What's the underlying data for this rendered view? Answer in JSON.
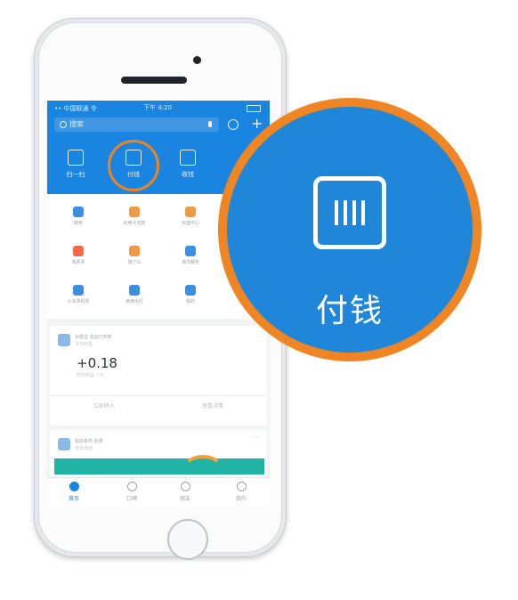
{
  "status_bar": {
    "carrier": "•• 中国联通 令",
    "time": "下午 4:20"
  },
  "search": {
    "placeholder": "搜索"
  },
  "top_functions": [
    {
      "label": "扫一扫",
      "icon": "scan-icon"
    },
    {
      "label": "付钱",
      "icon": "barcode-icon"
    },
    {
      "label": "收钱",
      "icon": "receive-icon"
    }
  ],
  "grid": [
    {
      "label": "转账",
      "icon": "transfer-icon",
      "color": "#3b8fe0"
    },
    {
      "label": "信用卡还款",
      "icon": "card-icon",
      "color": "#f09a48"
    },
    {
      "label": "充值中心",
      "icon": "phone-icon",
      "color": "#f09a48"
    },
    {
      "label": "淘票票",
      "icon": "ticket-icon",
      "color": "#f06a4a"
    },
    {
      "label": "饿了么",
      "icon": "food-icon",
      "color": "#f09a48"
    },
    {
      "label": "城市服务",
      "icon": "city-icon",
      "color": "#3b8fe0"
    },
    {
      "label": "火车票机票",
      "icon": "train-icon",
      "color": "#3b8fe0"
    },
    {
      "label": "滴滴出行",
      "icon": "car-icon",
      "color": "#3b8fe0"
    },
    {
      "label": "我的",
      "icon": "more-icon",
      "color": "#3b8fe0"
    }
  ],
  "card1": {
    "title": "余额宝 收益已到账",
    "subtitle": "今日收益",
    "amount": "+0.18",
    "amount_sub": "昨日收益（元）",
    "btn_left": "立即转入",
    "btn_right": "查看详情"
  },
  "card2": {
    "title": "蚂蚁森林 能量",
    "subtitle": "今日活动",
    "more": "···"
  },
  "tabs": [
    {
      "label": "首页",
      "icon": "home-icon",
      "active": true
    },
    {
      "label": "口碑",
      "icon": "koubei-icon",
      "active": false
    },
    {
      "label": "朋友",
      "icon": "friends-icon",
      "active": false
    },
    {
      "label": "我的",
      "icon": "me-icon",
      "active": false
    }
  ],
  "zoom": {
    "label": "付钱",
    "icon": "barcode-icon"
  },
  "colors": {
    "brand_blue": "#1a85e0",
    "highlight_orange": "#ef8523"
  }
}
